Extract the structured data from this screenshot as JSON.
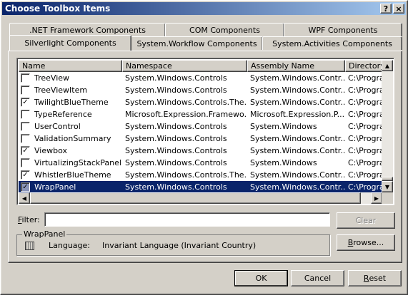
{
  "window": {
    "title": "Choose Toolbox Items",
    "help_btn": "?",
    "close_btn": "×"
  },
  "tabs_row1": [
    ".NET Framework Components",
    "COM Components",
    "WPF Components"
  ],
  "tabs_row2": [
    "Silverlight Components",
    "System.Workflow Components",
    "System.Activities Components"
  ],
  "columns": [
    "Name",
    "Namespace",
    "Assembly Name",
    "Directory"
  ],
  "rows": [
    {
      "checked": false,
      "name": "TreeView",
      "ns": "System.Windows.Controls",
      "asm": "System.Windows.Contr...",
      "dir": "C:\\Progra"
    },
    {
      "checked": false,
      "name": "TreeViewItem",
      "ns": "System.Windows.Controls",
      "asm": "System.Windows.Contr...",
      "dir": "C:\\Progra"
    },
    {
      "checked": true,
      "name": "TwilightBlueTheme",
      "ns": "System.Windows.Controls.The...",
      "asm": "System.Windows.Contr...",
      "dir": "C:\\Progra"
    },
    {
      "checked": false,
      "name": "TypeReference",
      "ns": "Microsoft.Expression.Framewo...",
      "asm": "Microsoft.Expression.P...",
      "dir": "C:\\Progra"
    },
    {
      "checked": false,
      "name": "UserControl",
      "ns": "System.Windows.Controls",
      "asm": "System.Windows",
      "dir": "C:\\Progra"
    },
    {
      "checked": false,
      "name": "ValidationSummary",
      "ns": "System.Windows.Controls",
      "asm": "System.Windows.Contr...",
      "dir": "C:\\Progra"
    },
    {
      "checked": true,
      "name": "Viewbox",
      "ns": "System.Windows.Controls",
      "asm": "System.Windows.Contr...",
      "dir": "C:\\Progra"
    },
    {
      "checked": false,
      "name": "VirtualizingStackPanel",
      "ns": "System.Windows.Controls",
      "asm": "System.Windows",
      "dir": "C:\\Progra"
    },
    {
      "checked": true,
      "name": "WhistlerBlueTheme",
      "ns": "System.Windows.Controls.The...",
      "asm": "System.Windows.Contr...",
      "dir": "C:\\Progra"
    },
    {
      "checked": true,
      "name": "WrapPanel",
      "ns": "System.Windows.Controls",
      "asm": "System.Windows.Contr...",
      "dir": "C:\\Progra",
      "selected": true
    }
  ],
  "filter": {
    "label_key": "F",
    "label_rest": "ilter:",
    "value": ""
  },
  "clear_btn": "Clear",
  "browse": {
    "key": "B",
    "rest": "rowse..."
  },
  "group": {
    "title": "WrapPanel",
    "language_label": "Language:",
    "language_value": "Invariant Language (Invariant Country)"
  },
  "ok_btn": "OK",
  "cancel_btn": "Cancel",
  "reset": {
    "key": "R",
    "rest": "eset"
  }
}
